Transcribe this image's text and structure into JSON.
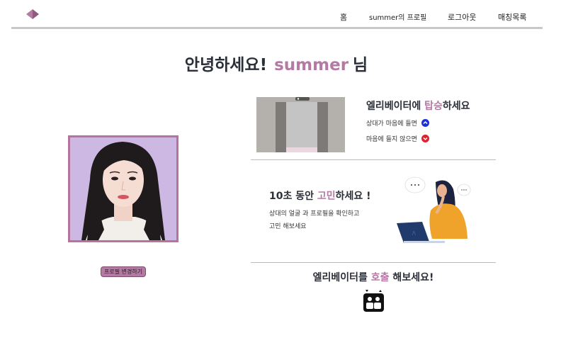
{
  "nav": {
    "home": "홈",
    "profile": "summer의 프로필",
    "logout": "로그아웃",
    "matches": "매칭목록"
  },
  "greeting": {
    "prefix": "안녕하세요!",
    "name": "summer",
    "suffix": "님"
  },
  "profile": {
    "edit_button": "프로필 변경하기"
  },
  "elevator_section": {
    "title_prefix": "엘리베이터에 ",
    "title_accent": "탑승",
    "title_suffix": "하세요",
    "like_label": "상대가 마음에 들면",
    "dislike_label": "마음에 들지 않으면"
  },
  "think_section": {
    "title_prefix": "10초 동안 ",
    "title_accent": "고민",
    "title_suffix": "하세요 !",
    "desc_line1": "상대의 얼굴 과 프로필을 확인하고",
    "desc_line2": "고민 해보세요"
  },
  "call_section": {
    "title_prefix": "엘리베이터를 ",
    "title_accent": "호출",
    "title_suffix": " 해보세요!"
  },
  "colors": {
    "accent": "#b57aa3",
    "like": "#1a2fd6",
    "dislike": "#e0202a",
    "text": "#2b2f38"
  },
  "icons": {
    "logo": "diamond-logo-icon",
    "like": "chevron-up-icon",
    "dislike": "chevron-down-icon",
    "call": "elevator-call-icon"
  }
}
